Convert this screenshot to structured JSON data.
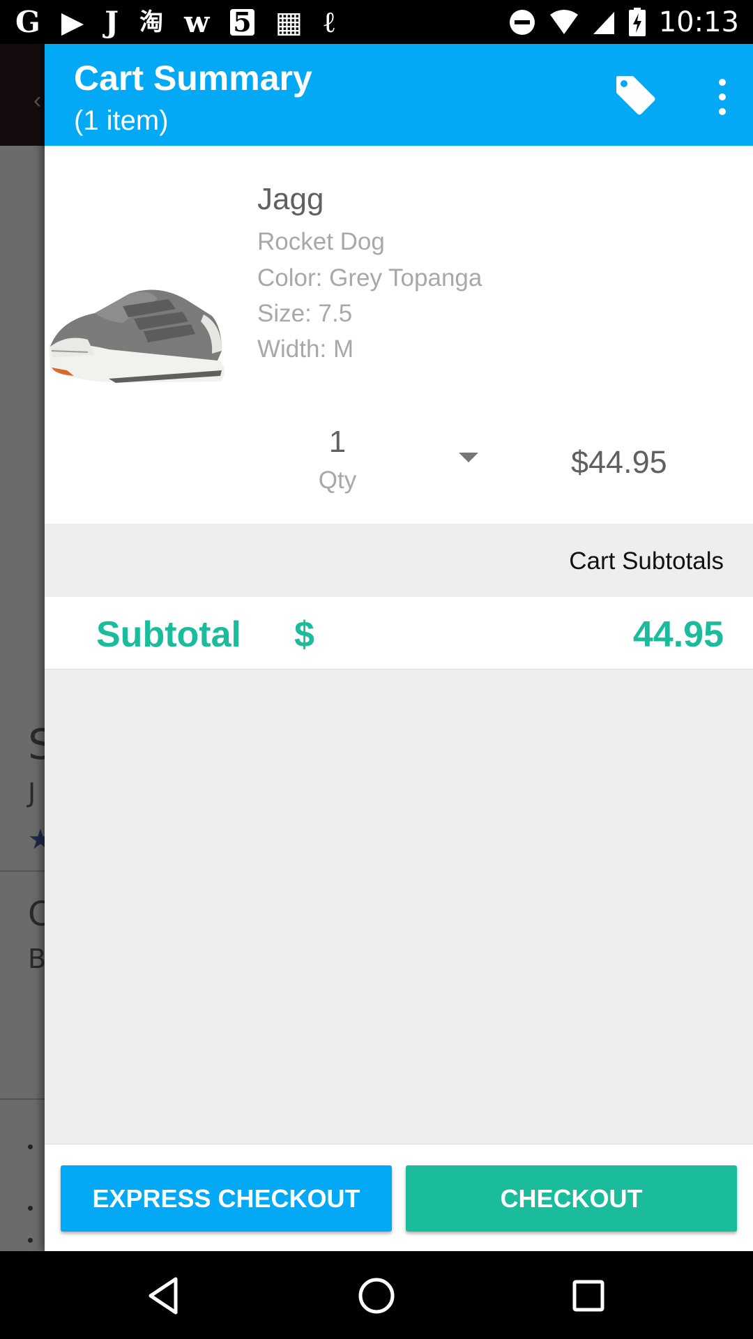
{
  "status_bar": {
    "notification_icons": [
      "G",
      "▶",
      "J",
      "淘",
      "w",
      "5",
      "▦",
      "ℓ"
    ],
    "time": "10:13"
  },
  "app_bar": {
    "title": "Cart Summary",
    "subtitle": "(1 item)",
    "icons": [
      "tag-icon",
      "more-vert-icon"
    ]
  },
  "cart_item": {
    "name": "Jagg",
    "brand": "Rocket Dog",
    "color_label": "Color:",
    "color": "Grey Topanga",
    "size_label": "Size:",
    "size": "7.5",
    "width_label": "Width:",
    "width": "M",
    "qty_value": "1",
    "qty_label": "Qty",
    "price": "$44.95"
  },
  "subtotals": {
    "header": "Cart Subtotals",
    "label": "Subtotal",
    "currency": "$",
    "amount": "44.95"
  },
  "actions": {
    "express_checkout": "EXPRESS CHECKOUT",
    "checkout": "CHECKOUT"
  },
  "colors": {
    "app_bar": "#03a9f4",
    "accent_green": "#1abc9c",
    "express_button": "#03a9f4",
    "checkout_button": "#1abc9c"
  }
}
